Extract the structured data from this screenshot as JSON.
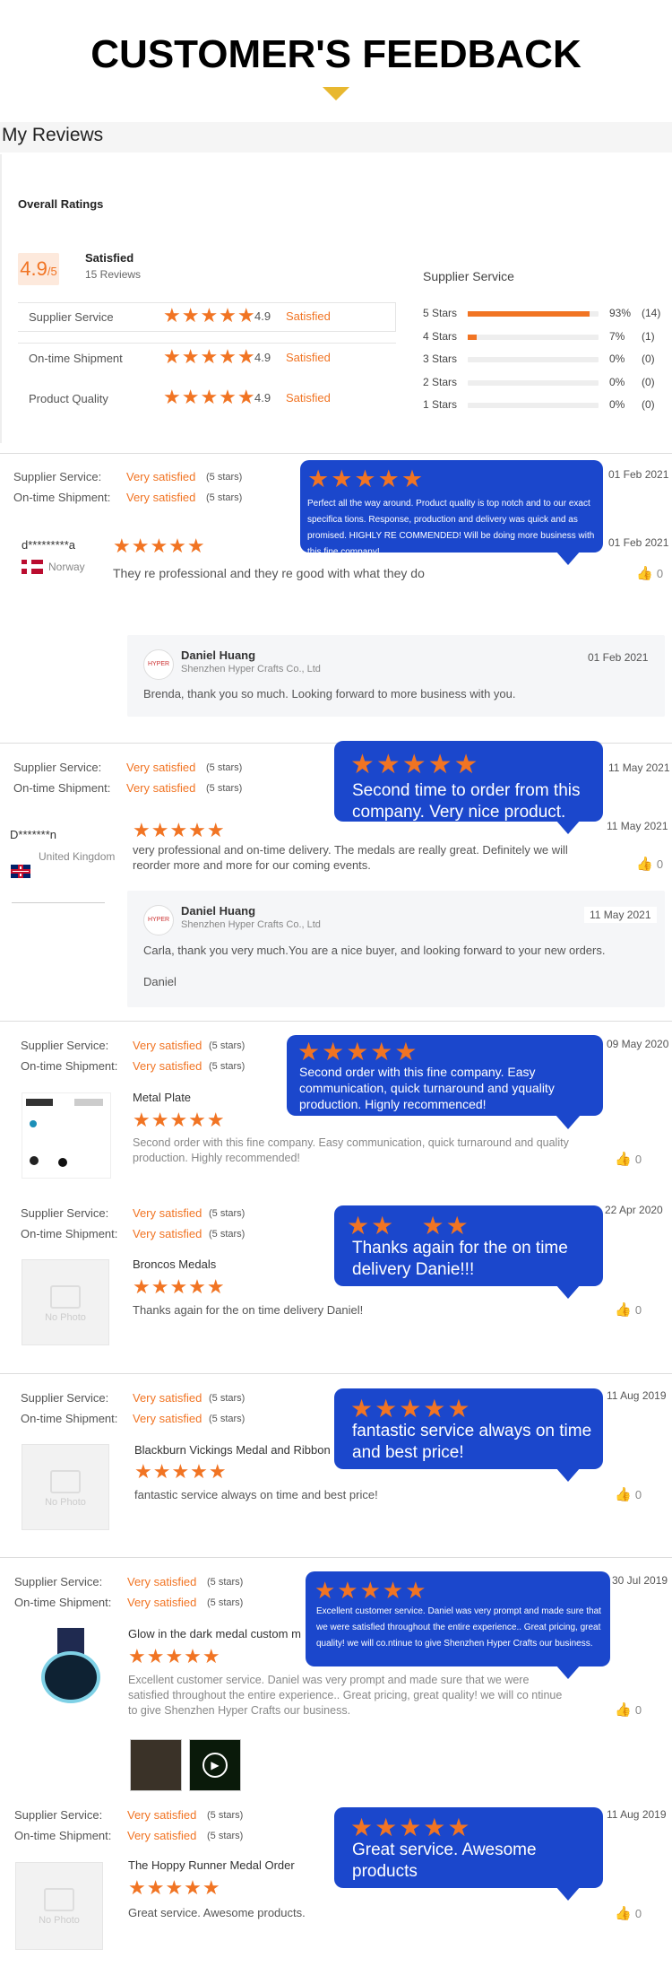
{
  "header": {
    "title": "CUSTOMER'S FEEDBACK"
  },
  "my_reviews": "My Reviews",
  "overall": {
    "heading": "Overall Ratings",
    "score": "4.9",
    "score_den": "/5",
    "verdict": "Satisfied",
    "count": "15 Reviews",
    "rows": [
      {
        "label": "Supplier Service",
        "score": "4.9",
        "verdict": "Satisfied"
      },
      {
        "label": "On-time Shipment",
        "score": "4.9",
        "verdict": "Satisfied"
      },
      {
        "label": "Product Quality",
        "score": "4.9",
        "verdict": "Satisfied"
      }
    ],
    "ss_heading": "Supplier Service",
    "bars": [
      {
        "label": "5 Stars",
        "pct": "93%",
        "count": "(14)",
        "fraction": 0.93
      },
      {
        "label": "4 Stars",
        "pct": "7%",
        "count": "(1)",
        "fraction": 0.07
      },
      {
        "label": "3 Stars",
        "pct": "0%",
        "count": "(0)",
        "fraction": 0
      },
      {
        "label": "2 Stars",
        "pct": "0%",
        "count": "(0)",
        "fraction": 0
      },
      {
        "label": "1 Stars",
        "pct": "0%",
        "count": "(0)",
        "fraction": 0
      }
    ]
  },
  "common": {
    "ss": "Supplier Service:",
    "os": "On-time Shipment:",
    "vs": "Very satisfied",
    "five": "(5 stars)",
    "stars": "★★★★★",
    "thumb_icon": "thumb-up-icon",
    "zero": "0",
    "no_photo": "No Photo"
  },
  "r1": {
    "date": "01 Feb 2021",
    "date2": "01 Feb 2021",
    "user": "d*********a",
    "country": "Norway",
    "text": "They re professional and they re good with what they do",
    "bubble": "Perfect all the way around. Product quality is top notch and to our exact specifica tions. Response, production and delivery was quick and as promised. HIGHLY RE COMMENDED! Will be doing more business with this fine company!",
    "reply": {
      "name": "Daniel Huang",
      "company": "Shenzhen Hyper Crafts Co., Ltd",
      "date": "01 Feb 2021",
      "text": "Brenda, thank you so much. Looking forward to more business with you."
    }
  },
  "r2": {
    "date": "11 May 2021",
    "date2": "11 May 2021",
    "user": "D*******n",
    "country": "United Kingdom",
    "text": "very professional and on-time delivery. The medals are really great. Definitely we will reorder more and more for our coming events.",
    "bubble": "Second time to order from this company. Very nice product.",
    "reply": {
      "name": "Daniel Huang",
      "company": "Shenzhen Hyper Crafts Co., Ltd",
      "date": "11 May 2021",
      "text": "Carla, thank you very much.You are a nice buyer, and looking forward to your new orders.",
      "sign": "Daniel"
    }
  },
  "r3": {
    "date": "09 May 2020",
    "product": "Metal Plate",
    "text": "Second order with this fine company.  Easy communication, quick turnaround and quality production.  Highly recommended!",
    "bubble": "Second order with this fine company. Easy communication, quick turnaround and yquality production. Hignly recommenced!"
  },
  "r4": {
    "date": "22 Apr 2020",
    "product": "Broncos Medals",
    "text": "Thanks again for the on time delivery Daniel!",
    "bubble": "Thanks again for the on time delivery Danie!!!"
  },
  "r5": {
    "date": "11 Aug 2019",
    "product": "Blackburn Vickings Medal and Ribbon",
    "text": "fantastic service always on time and best price!",
    "bubble": "fantastic service always on time and best price!"
  },
  "r6": {
    "date": "30 Jul 2019",
    "product": "Glow in the dark medal custom m",
    "text": "Excellent customer service. Daniel was very prompt and made sure that we were satisfied throughout the entire experience.. Great pricing, great quality! we will co ntinue to give Shenzhen Hyper Crafts our business.",
    "bubble": "Excellent customer service. Daniel was very prompt and made sure that we were satisfied throughout the entire experience.. Great pricing, great quality! we will co.ntinue to give Shenzhen Hyper Crafts our business."
  },
  "r7": {
    "date": "11 Aug 2019",
    "product": "The Hoppy Runner Medal Order",
    "text": "Great service.  Awesome products.",
    "bubble": "Great service. Awesome products"
  }
}
